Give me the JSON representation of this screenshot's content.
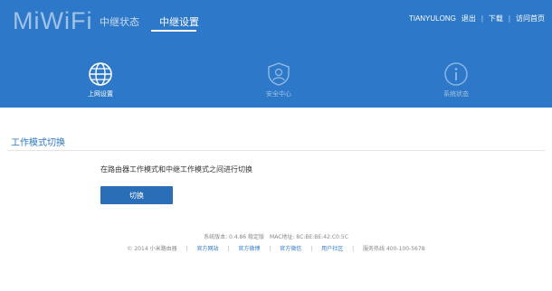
{
  "header": {
    "logo": "MiWiFi",
    "tabs": [
      {
        "label": "中继状态",
        "active": false
      },
      {
        "label": "中继设置",
        "active": true
      }
    ],
    "user": {
      "name": "TIANYULONG",
      "logout": "退出",
      "download": "下载",
      "old_version": "访问首页"
    }
  },
  "subnav": [
    {
      "label": "上网设置",
      "icon": "globe-icon",
      "active": true
    },
    {
      "label": "安全中心",
      "icon": "user-shield-icon",
      "active": false
    },
    {
      "label": "系统状态",
      "icon": "info-icon",
      "active": false
    }
  ],
  "section": {
    "title": "工作模式切换",
    "description": "在路由器工作模式和中继工作模式之间进行切换",
    "button_label": "切换"
  },
  "footer": {
    "system_version": "系统版本: 0.4.86 稳定版",
    "mac_address": "MAC地址: 8C:BE:BE:42:C0:5C",
    "copyright": "© 2014 小米路由器",
    "links": [
      "官方网站",
      "官方微博",
      "官方微信",
      "用户社区"
    ],
    "hotline": "服务热线 400-100-5678"
  },
  "colors": {
    "header_bg": "#2d78c8",
    "button_bg": "#2a6eb8",
    "accent": "#2d78c8"
  }
}
